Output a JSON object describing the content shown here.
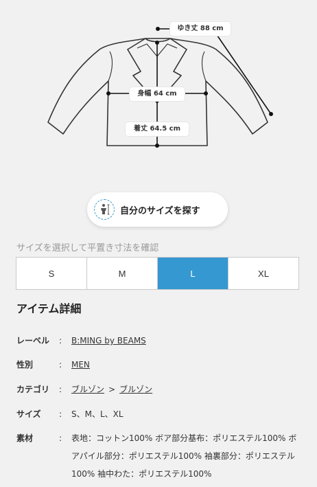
{
  "measurements": {
    "yuki": "ゆき丈 88 cm",
    "mihaba": "身幅 64 cm",
    "kitake": "着丈 64.5 cm"
  },
  "find_size": {
    "label": "自分のサイズを探す",
    "icon": "person-measure-icon"
  },
  "size_select": {
    "hint": "サイズを選択して平置き寸法を確認",
    "options": [
      "S",
      "M",
      "L",
      "XL"
    ],
    "selected": "L",
    "accent_color": "#3598d0"
  },
  "details": {
    "title": "アイテム詳細",
    "separator": ":",
    "label": {
      "key": "レーベル",
      "value": "B:MING by BEAMS"
    },
    "gender": {
      "key": "性別",
      "value": "MEN"
    },
    "category": {
      "key": "カテゴリ",
      "parent": "ブルゾン",
      "arrow": ">",
      "child": "ブルゾン"
    },
    "sizes": {
      "key": "サイズ",
      "value": "S、M、L、XL"
    },
    "material": {
      "key": "素材",
      "value": "表地：コットン100% ボア部分基布：ポリエステル100% ボアパイル部分：ポリエステル100% 袖裏部分：ポリエステル100% 袖中わた：ポリエステル100%"
    }
  }
}
